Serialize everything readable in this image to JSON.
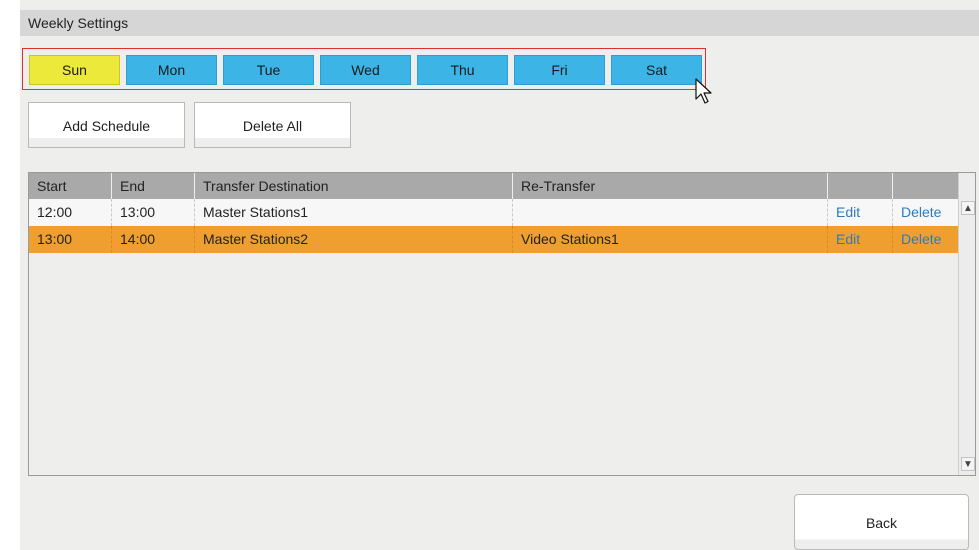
{
  "header": {
    "title": "Weekly Settings"
  },
  "days": [
    {
      "label": "Sun",
      "active": true
    },
    {
      "label": "Mon",
      "active": false
    },
    {
      "label": "Tue",
      "active": false
    },
    {
      "label": "Wed",
      "active": false
    },
    {
      "label": "Thu",
      "active": false
    },
    {
      "label": "Fri",
      "active": false
    },
    {
      "label": "Sat",
      "active": false
    }
  ],
  "actions": {
    "add_label": "Add Schedule",
    "delete_all_label": "Delete All"
  },
  "table": {
    "columns": [
      "Start",
      "End",
      "Transfer Destination",
      "Re-Transfer",
      "",
      ""
    ],
    "rows": [
      {
        "start": "12:00",
        "end": "13:00",
        "destination": "Master Stations1",
        "retransfer": "",
        "edit": "Edit",
        "delete": "Delete",
        "selected": false
      },
      {
        "start": "13:00",
        "end": "14:00",
        "destination": "Master Stations2",
        "retransfer": "Video Stations1",
        "edit": "Edit",
        "delete": "Delete",
        "selected": true
      }
    ]
  },
  "footer": {
    "back_label": "Back"
  },
  "colors": {
    "day_active": "#ece93a",
    "day_inactive": "#3db4e6",
    "row_selected": "#ef9f2f",
    "link": "#2a7cc2",
    "group_border": "#e0302c"
  },
  "icons": {
    "scroll_up": "scroll-up-arrow-icon",
    "scroll_down": "scroll-down-arrow-icon",
    "cursor": "mouse-pointer-icon"
  }
}
